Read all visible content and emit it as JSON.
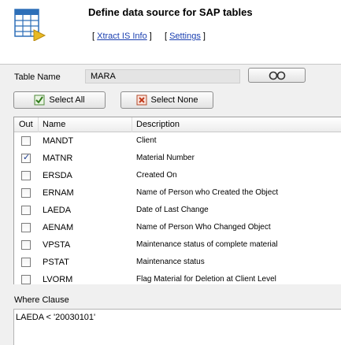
{
  "header": {
    "title": "Define data source for SAP tables",
    "link_bracket_open": "[",
    "link_bracket_close": "]",
    "link_info": "Xtract IS Info",
    "link_settings": "Settings",
    "icon": "table-icon"
  },
  "table_name": {
    "label": "Table Name",
    "value": "MARA",
    "lookup_icon": "binoculars-icon"
  },
  "toolbar": {
    "select_all_label": "Select All",
    "select_all_icon": "check-all-icon",
    "select_none_label": "Select None",
    "select_none_icon": "uncheck-all-icon"
  },
  "grid": {
    "columns": {
      "out": "Out",
      "name": "Name",
      "description": "Description"
    },
    "rows": [
      {
        "checked": false,
        "name": "MANDT",
        "description": "Client"
      },
      {
        "checked": true,
        "name": "MATNR",
        "description": "Material Number"
      },
      {
        "checked": false,
        "name": "ERSDA",
        "description": "Created On"
      },
      {
        "checked": false,
        "name": "ERNAM",
        "description": "Name of Person who Created the Object"
      },
      {
        "checked": false,
        "name": "LAEDA",
        "description": "Date of Last Change"
      },
      {
        "checked": false,
        "name": "AENAM",
        "description": "Name of Person Who Changed Object"
      },
      {
        "checked": false,
        "name": "VPSTA",
        "description": "Maintenance status of complete material"
      },
      {
        "checked": false,
        "name": "PSTAT",
        "description": "Maintenance status"
      },
      {
        "checked": false,
        "name": "LVORM",
        "description": "Flag Material for Deletion at Client Level"
      }
    ]
  },
  "where": {
    "label": "Where Clause",
    "value": "LAEDA < '20030101'"
  },
  "colors": {
    "link": "#1a3fb0",
    "check": "#1b3a8f"
  }
}
